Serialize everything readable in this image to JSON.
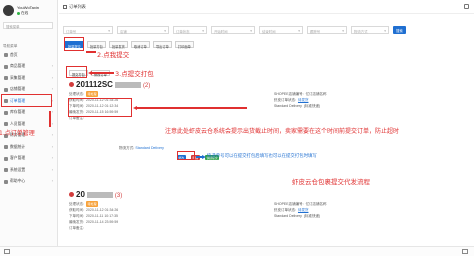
{
  "sidebar": {
    "user_name": "YouWoTaxin",
    "status": "在线",
    "search_placeholder": "搜索菜单",
    "section": "导航菜单",
    "items": [
      {
        "label": "首页",
        "arrow": ""
      },
      {
        "label": "商品管理",
        "arrow": "›"
      },
      {
        "label": "采集管理",
        "arrow": "›"
      },
      {
        "label": "店铺管理",
        "arrow": "›"
      },
      {
        "label": "订单管理",
        "arrow": "›"
      },
      {
        "label": "库存管理",
        "arrow": "›"
      },
      {
        "label": "人员管理",
        "arrow": "›"
      },
      {
        "label": "财务管理",
        "arrow": "›"
      },
      {
        "label": "数据统计",
        "arrow": "›"
      },
      {
        "label": "客户管理",
        "arrow": "›"
      },
      {
        "label": "系统设置",
        "arrow": "›"
      },
      {
        "label": "帮助中心",
        "arrow": "›"
      }
    ]
  },
  "header": {
    "title": "订单列表"
  },
  "filters": {
    "fields": [
      "订单号",
      "店铺",
      "订单状态",
      "开始时间",
      "结束时间",
      "跟踪号",
      "物流方式"
    ],
    "button": "搜索"
  },
  "actions": [
    "批量提交",
    "批量打包",
    "批量发货",
    "取消订单",
    "导出订单",
    "打印面单"
  ],
  "card_buttons": [
    "提交打包",
    "修改订单"
  ],
  "orders": [
    {
      "number": "201112SC",
      "count": "(2)",
      "lines": [
        {
          "k": "处理状态:",
          "v": "待处理",
          "tag": true
        },
        {
          "k": "获取时间:",
          "v": "2020-11-12 01:34:26"
        },
        {
          "k": "下单时间:",
          "v": "2020-11-12 01:12:34"
        },
        {
          "k": "最晚发货:",
          "v": "2020-11-15 16:59:59"
        },
        {
          "k": "订单备注:",
          "v": ""
        }
      ],
      "right": [
        {
          "k": "SHOPEE店铺编号:",
          "v": "亿订店铺名称"
        },
        {
          "k": "虾皮订单状态:",
          "v": "待发货",
          "link": true
        },
        {
          "k": "Standard Delivery",
          "v": "(标准快递)"
        }
      ]
    },
    {
      "number": "20",
      "count": "(3)",
      "lines": [
        {
          "k": "处理状态:",
          "v": "待处理",
          "tag": true
        },
        {
          "k": "获取时间:",
          "v": "2020-11-12 01:34:26"
        },
        {
          "k": "下单时间:",
          "v": "2020-11-11 10:17:35"
        },
        {
          "k": "最晚发货:",
          "v": "2020-11-14 23:59:59"
        },
        {
          "k": "订单备注:",
          "v": ""
        }
      ],
      "right": [
        {
          "k": "SHOPEE店铺编号:",
          "v": "亿订店铺名称"
        },
        {
          "k": "虾皮订单状态:",
          "v": "待发货",
          "link": true
        },
        {
          "k": "Standard Delivery",
          "v": "(标准快递)"
        }
      ]
    }
  ],
  "shipping": {
    "label": "物流方式:",
    "value": "Standard Delivery",
    "line2": "规格: Model: 1"
  },
  "mini_buttons": [
    "修改",
    "删除",
    "快捷提交"
  ],
  "annotations": {
    "a1": "1.点订单管理",
    "a2": "2.点我提交",
    "a3": "3.点提交打包",
    "a4": "注意此处虾皮云仓系统会提示出货截止时间，卖家需要在这个时间前提交订单，防止超时",
    "a5": "快递单号可以在提交打包后填写也可以在提交打包时填写",
    "a6": "虾皮云仓包裹提交代发流程"
  },
  "colors": {
    "accent": "#1f6fd1",
    "annotation": "#e03030",
    "tag": "#f7a23b"
  }
}
